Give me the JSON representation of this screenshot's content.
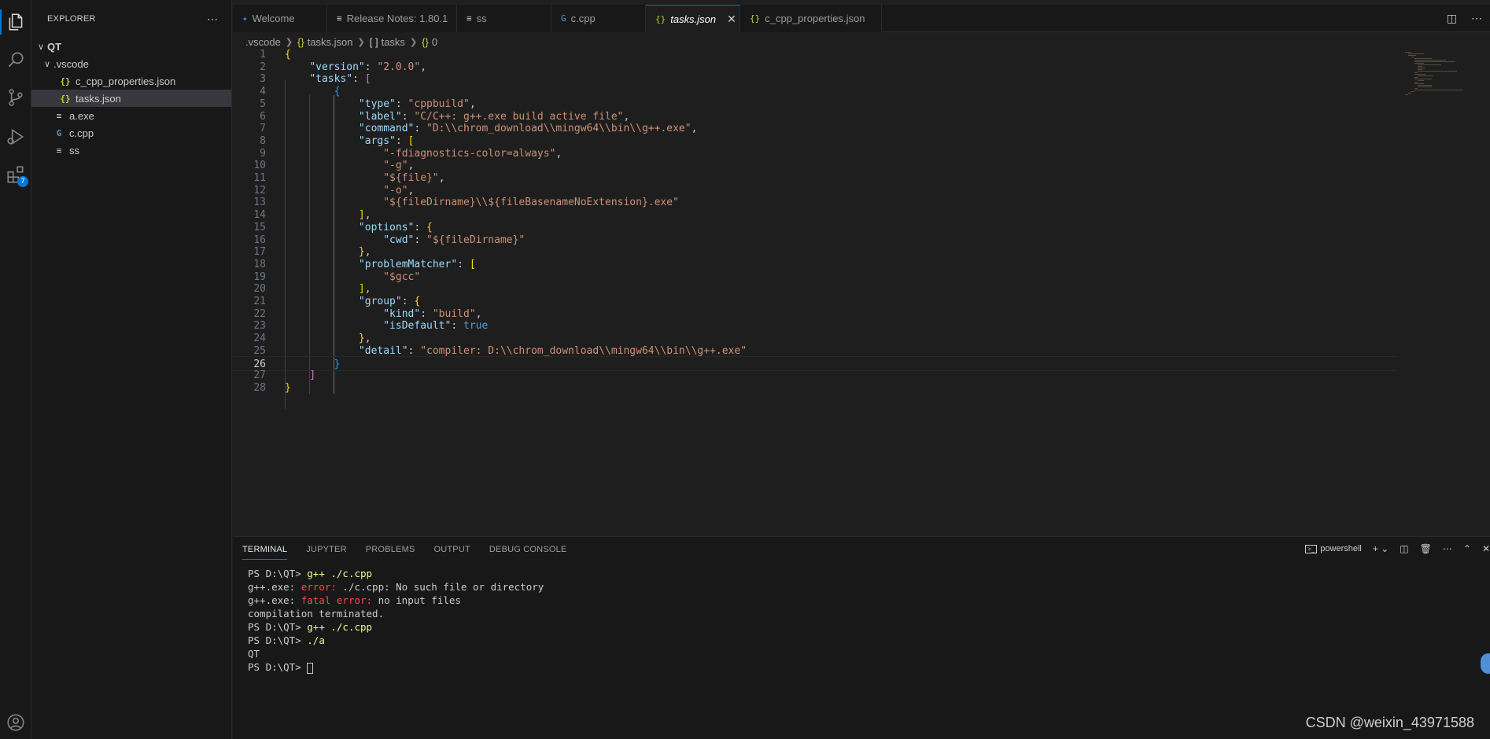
{
  "sidebar": {
    "title": "EXPLORER",
    "more": "⋯",
    "tree": [
      {
        "label": "QT",
        "chevron": "∨",
        "icon": "",
        "icon_type": "",
        "indent": 0,
        "selected": false
      },
      {
        "label": ".vscode",
        "chevron": "∨",
        "icon": "",
        "icon_type": "",
        "indent": 1,
        "selected": false
      },
      {
        "label": "c_cpp_properties.json",
        "chevron": "",
        "icon": "{}",
        "icon_type": "json",
        "indent": 2,
        "selected": false
      },
      {
        "label": "tasks.json",
        "chevron": "",
        "icon": "{}",
        "icon_type": "json",
        "indent": 2,
        "selected": true
      },
      {
        "label": "a.exe",
        "chevron": "",
        "icon": "≡",
        "icon_type": "txt",
        "indent": 1,
        "selected": false
      },
      {
        "label": "c.cpp",
        "chevron": "",
        "icon": "G",
        "icon_type": "cpp",
        "indent": 1,
        "selected": false
      },
      {
        "label": "ss",
        "chevron": "",
        "icon": "≡",
        "icon_type": "txt",
        "indent": 1,
        "selected": false
      }
    ]
  },
  "activity": {
    "extensions_badge": "7"
  },
  "tabs": [
    {
      "label": "Welcome",
      "icon": "✦",
      "icon_color": "#3794ff",
      "active": false
    },
    {
      "label": "Release Notes: 1.80.1",
      "icon": "≡",
      "icon_color": "#cccccc",
      "active": false
    },
    {
      "label": "ss",
      "icon": "≡",
      "icon_color": "#cccccc",
      "active": false
    },
    {
      "label": "c.cpp",
      "icon": "G",
      "icon_color": "#519aba",
      "active": false
    },
    {
      "label": "tasks.json",
      "icon": "{}",
      "icon_color": "#cbcb41",
      "active": true
    },
    {
      "label": "c_cpp_properties.json",
      "icon": "{}",
      "icon_color": "#cbcb41",
      "active": false
    }
  ],
  "tab_close": "✕",
  "breadcrumb": [
    {
      "icon": "",
      "label": ".vscode"
    },
    {
      "icon": "{}",
      "label": "tasks.json"
    },
    {
      "icon": "[ ]",
      "label": "tasks"
    },
    {
      "icon": "{}",
      "label": "0"
    }
  ],
  "editor": {
    "current_line": 26,
    "lines": [
      [
        [
          "b1",
          "{"
        ]
      ],
      [
        [
          "p",
          "    "
        ],
        [
          "k",
          "\"version\""
        ],
        [
          "p",
          ": "
        ],
        [
          "s",
          "\"2.0.0\""
        ],
        [
          "p",
          ","
        ]
      ],
      [
        [
          "p",
          "    "
        ],
        [
          "k",
          "\"tasks\""
        ],
        [
          "p",
          ": "
        ],
        [
          "b2",
          "["
        ]
      ],
      [
        [
          "p",
          "        "
        ],
        [
          "b3",
          "{"
        ]
      ],
      [
        [
          "p",
          "            "
        ],
        [
          "k",
          "\"type\""
        ],
        [
          "p",
          ": "
        ],
        [
          "s",
          "\"cppbuild\""
        ],
        [
          "p",
          ","
        ]
      ],
      [
        [
          "p",
          "            "
        ],
        [
          "k",
          "\"label\""
        ],
        [
          "p",
          ": "
        ],
        [
          "s",
          "\"C/C++: g++.exe build active file\""
        ],
        [
          "p",
          ","
        ]
      ],
      [
        [
          "p",
          "            "
        ],
        [
          "k",
          "\"command\""
        ],
        [
          "p",
          ": "
        ],
        [
          "s",
          "\"D:\\\\chrom_download\\\\mingw64\\\\bin\\\\g++.exe\""
        ],
        [
          "p",
          ","
        ]
      ],
      [
        [
          "p",
          "            "
        ],
        [
          "k",
          "\"args\""
        ],
        [
          "p",
          ": "
        ],
        [
          "b1",
          "["
        ]
      ],
      [
        [
          "p",
          "                "
        ],
        [
          "s",
          "\"-fdiagnostics-color=always\""
        ],
        [
          "p",
          ","
        ]
      ],
      [
        [
          "p",
          "                "
        ],
        [
          "s",
          "\"-g\""
        ],
        [
          "p",
          ","
        ]
      ],
      [
        [
          "p",
          "                "
        ],
        [
          "s",
          "\"${file}\""
        ],
        [
          "p",
          ","
        ]
      ],
      [
        [
          "p",
          "                "
        ],
        [
          "s",
          "\"-o\""
        ],
        [
          "p",
          ","
        ]
      ],
      [
        [
          "p",
          "                "
        ],
        [
          "s",
          "\"${fileDirname}\\\\${fileBasenameNoExtension}.exe\""
        ]
      ],
      [
        [
          "p",
          "            "
        ],
        [
          "b1",
          "]"
        ],
        [
          "p",
          ","
        ]
      ],
      [
        [
          "p",
          "            "
        ],
        [
          "k",
          "\"options\""
        ],
        [
          "p",
          ": "
        ],
        [
          "b1",
          "{"
        ]
      ],
      [
        [
          "p",
          "                "
        ],
        [
          "k",
          "\"cwd\""
        ],
        [
          "p",
          ": "
        ],
        [
          "s",
          "\"${fileDirname}\""
        ]
      ],
      [
        [
          "p",
          "            "
        ],
        [
          "b1",
          "}"
        ],
        [
          "p",
          ","
        ]
      ],
      [
        [
          "p",
          "            "
        ],
        [
          "k",
          "\"problemMatcher\""
        ],
        [
          "p",
          ": "
        ],
        [
          "b1",
          "["
        ]
      ],
      [
        [
          "p",
          "                "
        ],
        [
          "s",
          "\"$gcc\""
        ]
      ],
      [
        [
          "p",
          "            "
        ],
        [
          "b1",
          "]"
        ],
        [
          "p",
          ","
        ]
      ],
      [
        [
          "p",
          "            "
        ],
        [
          "k",
          "\"group\""
        ],
        [
          "p",
          ": "
        ],
        [
          "b1",
          "{"
        ]
      ],
      [
        [
          "p",
          "                "
        ],
        [
          "k",
          "\"kind\""
        ],
        [
          "p",
          ": "
        ],
        [
          "s",
          "\"build\""
        ],
        [
          "p",
          ","
        ]
      ],
      [
        [
          "p",
          "                "
        ],
        [
          "k",
          "\"isDefault\""
        ],
        [
          "p",
          ": "
        ],
        [
          "bool",
          "true"
        ]
      ],
      [
        [
          "p",
          "            "
        ],
        [
          "b1",
          "}"
        ],
        [
          "p",
          ","
        ]
      ],
      [
        [
          "p",
          "            "
        ],
        [
          "k",
          "\"detail\""
        ],
        [
          "p",
          ": "
        ],
        [
          "s",
          "\"compiler: D:\\\\chrom_download\\\\mingw64\\\\bin\\\\g++.exe\""
        ]
      ],
      [
        [
          "p",
          "        "
        ],
        [
          "b3",
          "}"
        ]
      ],
      [
        [
          "p",
          "    "
        ],
        [
          "b2",
          "]"
        ]
      ],
      [
        [
          "b1",
          "}"
        ]
      ]
    ]
  },
  "panel": {
    "tabs": [
      "TERMINAL",
      "JUPYTER",
      "PROBLEMS",
      "OUTPUT",
      "DEBUG CONSOLE"
    ],
    "active_tab": "TERMINAL",
    "shell_label": "powershell",
    "terminal_lines": [
      [
        [
          "p",
          "PS D:\\QT> "
        ],
        [
          "cmd",
          "g++ ./c.cpp"
        ]
      ],
      [
        [
          "p",
          "g++.exe: "
        ],
        [
          "err",
          "error: "
        ],
        [
          "p",
          "./c.cpp: No such file or directory"
        ]
      ],
      [
        [
          "p",
          "g++.exe: "
        ],
        [
          "err",
          "fatal error: "
        ],
        [
          "p",
          "no input files"
        ]
      ],
      [
        [
          "p",
          "compilation terminated."
        ]
      ],
      [
        [
          "p",
          "PS D:\\QT> "
        ],
        [
          "cmd",
          "g++ ./c.cpp"
        ]
      ],
      [
        [
          "p",
          "PS D:\\QT> "
        ],
        [
          "cmd",
          "./a"
        ]
      ],
      [
        [
          "p",
          "QT"
        ]
      ],
      [
        [
          "p",
          "PS D:\\QT> "
        ],
        [
          "cursor",
          ""
        ]
      ]
    ]
  },
  "watermark": "CSDN @weixin_43971588"
}
